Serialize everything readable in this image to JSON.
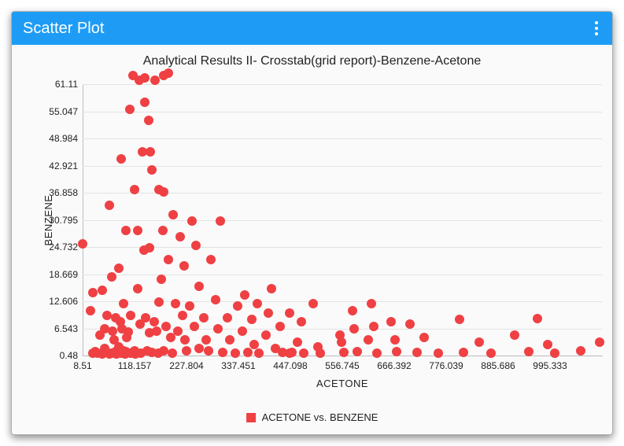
{
  "header": {
    "title": "Scatter Plot"
  },
  "chart_data": {
    "type": "scatter",
    "title": "Analytical Results II- Crosstab(grid report)-Benzene-Acetone",
    "xlabel": "ACETONE",
    "ylabel": "BENZENE",
    "xlim": [
      8.51,
      1104.98
    ],
    "ylim": [
      0.48,
      61.11
    ],
    "x_ticks": [
      8.51,
      118.157,
      227.804,
      337.451,
      447.098,
      556.745,
      666.392,
      776.039,
      885.686,
      995.333
    ],
    "y_ticks": [
      0.48,
      6.543,
      12.606,
      18.669,
      24.732,
      30.795,
      36.858,
      42.921,
      48.984,
      55.047,
      61.11
    ],
    "y_grid": [
      6.543,
      12.606,
      18.669,
      24.732,
      30.795,
      36.858,
      42.921,
      48.984,
      55.047,
      61.11
    ],
    "legend": [
      "ACETONE vs. BENZENE"
    ],
    "point_color": "#ef4043",
    "series": [
      {
        "name": "ACETONE vs. BENZENE",
        "points": [
          [
            8.51,
            25.5
          ],
          [
            25,
            10.5
          ],
          [
            30,
            14.5
          ],
          [
            30,
            1.0
          ],
          [
            35,
            1.3
          ],
          [
            40,
            1.0
          ],
          [
            45,
            5.0
          ],
          [
            50,
            15.0
          ],
          [
            50,
            0.8
          ],
          [
            55,
            2.0
          ],
          [
            55,
            6.5
          ],
          [
            60,
            9.5
          ],
          [
            60,
            1.2
          ],
          [
            65,
            0.8
          ],
          [
            65,
            34.0
          ],
          [
            70,
            18.0
          ],
          [
            70,
            1.0
          ],
          [
            72,
            6.0
          ],
          [
            75,
            4.0
          ],
          [
            78,
            9.0
          ],
          [
            78,
            1.3
          ],
          [
            80,
            0.8
          ],
          [
            85,
            2.5
          ],
          [
            85,
            20.0
          ],
          [
            88,
            8.0
          ],
          [
            90,
            1.0
          ],
          [
            90,
            44.5
          ],
          [
            92,
            6.5
          ],
          [
            95,
            12.0
          ],
          [
            95,
            1.5
          ],
          [
            98,
            0.8
          ],
          [
            100,
            28.5
          ],
          [
            100,
            1.3
          ],
          [
            102,
            4.5
          ],
          [
            105,
            5.8
          ],
          [
            108,
            55.5
          ],
          [
            110,
            1.0
          ],
          [
            110,
            9.5
          ],
          [
            115,
            63.0
          ],
          [
            118,
            37.5
          ],
          [
            118,
            1.5
          ],
          [
            120,
            0.8
          ],
          [
            125,
            28.5
          ],
          [
            125,
            15.5
          ],
          [
            128,
            62.0
          ],
          [
            130,
            7.5
          ],
          [
            132,
            1.0
          ],
          [
            135,
            46.0
          ],
          [
            138,
            24.0
          ],
          [
            140,
            62.5
          ],
          [
            140,
            57.0
          ],
          [
            142,
            9.0
          ],
          [
            145,
            1.5
          ],
          [
            148,
            53.0
          ],
          [
            150,
            5.5
          ],
          [
            150,
            24.5
          ],
          [
            152,
            46.0
          ],
          [
            155,
            42.0
          ],
          [
            155,
            1.2
          ],
          [
            160,
            8.0
          ],
          [
            162,
            62.0
          ],
          [
            165,
            6.0
          ],
          [
            168,
            1.0
          ],
          [
            170,
            12.5
          ],
          [
            170,
            37.5
          ],
          [
            175,
            17.5
          ],
          [
            178,
            28.5
          ],
          [
            180,
            37.0
          ],
          [
            180,
            63.0
          ],
          [
            180,
            1.5
          ],
          [
            185,
            7.0
          ],
          [
            190,
            22.0
          ],
          [
            190,
            63.5
          ],
          [
            195,
            4.5
          ],
          [
            198,
            1.0
          ],
          [
            200,
            32.0
          ],
          [
            205,
            12.0
          ],
          [
            210,
            6.0
          ],
          [
            215,
            27.0
          ],
          [
            220,
            9.5
          ],
          [
            222,
            20.5
          ],
          [
            225,
            4.0
          ],
          [
            228,
            1.5
          ],
          [
            235,
            11.5
          ],
          [
            240,
            30.5
          ],
          [
            245,
            7.0
          ],
          [
            248,
            25.0
          ],
          [
            255,
            2.0
          ],
          [
            255,
            16.0
          ],
          [
            265,
            9.0
          ],
          [
            270,
            4.0
          ],
          [
            275,
            1.5
          ],
          [
            280,
            22.0
          ],
          [
            290,
            13.0
          ],
          [
            295,
            6.5
          ],
          [
            300,
            30.5
          ],
          [
            305,
            1.2
          ],
          [
            315,
            9.0
          ],
          [
            320,
            4.0
          ],
          [
            330,
            1.0
          ],
          [
            335,
            11.5
          ],
          [
            345,
            6.0
          ],
          [
            350,
            14.0
          ],
          [
            358,
            1.2
          ],
          [
            365,
            8.5
          ],
          [
            370,
            3.0
          ],
          [
            378,
            12.0
          ],
          [
            380,
            1.0
          ],
          [
            395,
            5.0
          ],
          [
            400,
            10.0
          ],
          [
            408,
            15.5
          ],
          [
            415,
            2.0
          ],
          [
            425,
            7.0
          ],
          [
            430,
            1.2
          ],
          [
            445,
            10.0
          ],
          [
            445,
            1.0
          ],
          [
            450,
            1.2
          ],
          [
            462,
            3.5
          ],
          [
            470,
            8.0
          ],
          [
            475,
            1.0
          ],
          [
            495,
            12.0
          ],
          [
            505,
            2.5
          ],
          [
            510,
            1.0
          ],
          [
            552,
            5.0
          ],
          [
            555,
            3.5
          ],
          [
            560,
            1.2
          ],
          [
            578,
            10.5
          ],
          [
            582,
            6.5
          ],
          [
            588,
            1.3
          ],
          [
            612,
            4.0
          ],
          [
            618,
            12.0
          ],
          [
            623,
            7.0
          ],
          [
            630,
            1.0
          ],
          [
            660,
            8.0
          ],
          [
            668,
            4.0
          ],
          [
            672,
            1.3
          ],
          [
            700,
            7.5
          ],
          [
            715,
            1.2
          ],
          [
            730,
            4.5
          ],
          [
            760,
            1.0
          ],
          [
            805,
            8.5
          ],
          [
            812,
            1.2
          ],
          [
            845,
            3.5
          ],
          [
            870,
            1.0
          ],
          [
            920,
            5.0
          ],
          [
            950,
            1.4
          ],
          [
            968,
            8.8
          ],
          [
            990,
            3.0
          ],
          [
            1005,
            1.0
          ],
          [
            1060,
            1.5
          ],
          [
            1100,
            3.5
          ]
        ]
      }
    ]
  }
}
